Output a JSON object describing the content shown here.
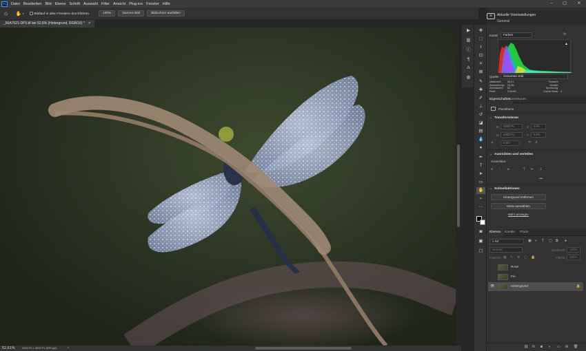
{
  "menu": {
    "app_icon": "Ps",
    "items": [
      "Datei",
      "Bearbeiten",
      "Bild",
      "Ebene",
      "Schrift",
      "Auswahl",
      "Filter",
      "Ansicht",
      "Plug-ins",
      "Fenster",
      "Hilfe"
    ],
    "window_controls": [
      "–",
      "▢",
      "✕"
    ]
  },
  "options": {
    "scroll_all_label": "Bildlauf in allen Fenstern durchführen",
    "zoom_100": "100%",
    "fit_screen": "Ganzes Bild",
    "fill_screen": "Bildschirm ausfüllen"
  },
  "document": {
    "tab_title": "_56A7621-DP3.tif bei 52,6% (Hintergrund, RGB/16) *",
    "close_glyph": "×"
  },
  "status": {
    "zoom": "52,61%",
    "dimensions": "4000 Px x 4000 Px (300 ppi)",
    "arrow": "›"
  },
  "learn_panel": {
    "title": "Aktuelle Voreinstellungen",
    "subtitle": "General"
  },
  "histogram": {
    "channel_label": "Kanal:",
    "channel_value": "Farben",
    "source_label": "Quelle:",
    "source_value": "Gesamtes Bild",
    "warning_glyph": "▲",
    "stats_left_labels": [
      "Mittelwert:",
      "Abweichung:",
      "Zentralwert:",
      "Pixel:"
    ],
    "stats_left_values": [
      "65,57",
      "24,36",
      "63",
      "375000"
    ],
    "stats_right_labels": [
      "Tonwert:",
      "Anzahl:",
      "Spreizung:",
      "Cache-Stufe:"
    ],
    "stats_right_values": [
      "",
      "",
      "",
      "4"
    ],
    "colors": [
      "#ff2a2a",
      "#2a9bff",
      "#b040ff",
      "#22ff44",
      "#ffee22",
      "#00e5ff",
      "#ff40ff"
    ]
  },
  "properties": {
    "tabs": [
      "Eigenschaften",
      "Korrekturen"
    ],
    "layer_type": "Pixelebene",
    "transform_title": "Transformieren",
    "w_label": "B",
    "w_value": "4000 Px",
    "h_label": "H",
    "h_value": "4000 Px",
    "x_label": "X",
    "x_value": "0 Px",
    "y_label": "Y",
    "y_value": "0 Px",
    "angle_value": "0,00°",
    "align_title": "Ausrichten und verteilen",
    "align_sub": "Ausrichten:",
    "quick_title": "Schnellaktionen",
    "btn_remove_bg": "Hintergrund entfernen",
    "btn_select_subject": "Motiv auswählen",
    "more": "Mehr anzeigen",
    "ellipsis": "•••"
  },
  "layers": {
    "tabs": [
      "Ebenen",
      "Kanäle",
      "Pfade"
    ],
    "filter_label": "Art",
    "blend_mode": "Normal",
    "opacity_label": "Deckkraft:",
    "opacity_value": "100%",
    "lock_label": "Fixieren:",
    "fill_label": "Fläche:",
    "fill_value": "100%",
    "items": [
      {
        "name": "RAW",
        "visible": false,
        "selected": false
      },
      {
        "name": "Fin",
        "visible": false,
        "selected": false
      },
      {
        "name": "Hintergrund",
        "visible": true,
        "selected": true
      }
    ],
    "bottom_icons": [
      "link-icon",
      "fx-icon",
      "mask-icon",
      "adjustment-icon",
      "group-icon",
      "new-layer-icon",
      "trash-icon"
    ],
    "fx": "fx"
  },
  "tools": [
    "move-icon",
    "marquee-icon",
    "lasso-icon",
    "object-select-icon",
    "crop-icon",
    "frame-icon",
    "eyedropper-icon",
    "healing-icon",
    "brush-icon",
    "stamp-icon",
    "history-brush-icon",
    "eraser-icon",
    "gradient-icon",
    "blur-icon",
    "dodge-icon",
    "pen-icon",
    "type-icon",
    "path-select-icon",
    "rectangle-icon",
    "hand-icon",
    "zoom-icon",
    "more-tools-icon"
  ],
  "colors": {
    "accent": "#1473e6",
    "panel_bg": "#323232",
    "canvas_bg": "#2f3a25"
  }
}
